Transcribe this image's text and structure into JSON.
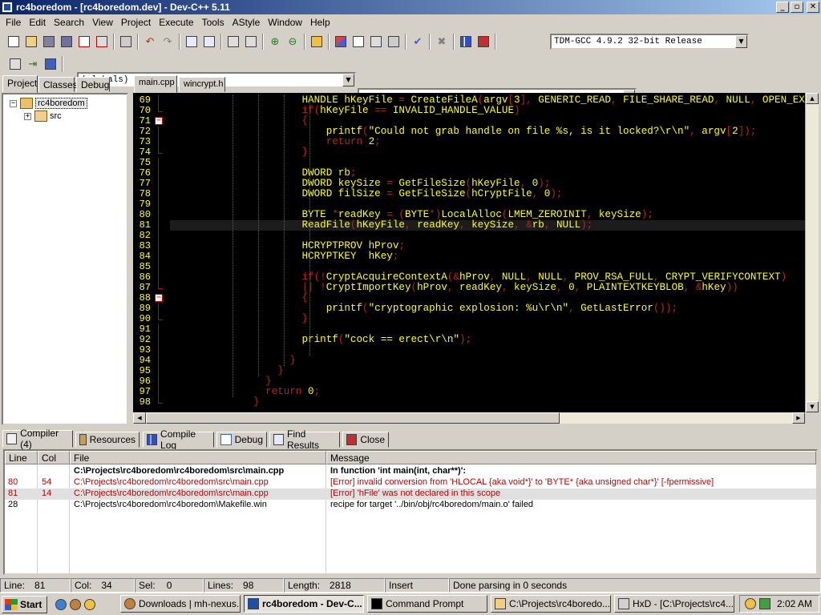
{
  "window": {
    "title": "rc4boredom - [rc4boredom.dev] - Dev-C++ 5.11",
    "minimize": "_",
    "restore": "▫",
    "close": "✕"
  },
  "menu": [
    "File",
    "Edit",
    "Search",
    "View",
    "Project",
    "Execute",
    "Tools",
    "AStyle",
    "Window",
    "Help"
  ],
  "toolbar": {
    "compiler_select": "TDM-GCC 4.9.2 32-bit Release",
    "scope_select": "(globals)",
    "member_select": ""
  },
  "left_panel": {
    "tabs": [
      "Project",
      "Classes",
      "Debug"
    ],
    "active_tab": "Project",
    "tree": {
      "root": "rc4boredom",
      "root_expander": "−",
      "child": "src",
      "child_expander": "+"
    }
  },
  "editor": {
    "tabs": [
      "main.cpp",
      "wincrypt.h"
    ],
    "active_tab": "main.cpp",
    "current_line": 81,
    "fold_marker": "−",
    "lines": [
      {
        "n": "69",
        "code": "        HANDLE hKeyFile = CreateFileA(argv[3], GENERIC_READ, FILE_SHARE_READ, NULL, OPEN_EX"
      },
      {
        "n": "70",
        "code": "        if(hKeyFile == INVALID_HANDLE_VALUE)"
      },
      {
        "n": "71",
        "code": "        {"
      },
      {
        "n": "72",
        "code": "            printf(\"Could not grab handle on file %s, is it locked?\\r\\n\", argv[2]);"
      },
      {
        "n": "73",
        "code": "            return 2;"
      },
      {
        "n": "74",
        "code": "        }"
      },
      {
        "n": "75",
        "code": ""
      },
      {
        "n": "76",
        "code": "        DWORD rb;"
      },
      {
        "n": "77",
        "code": "        DWORD keySize = GetFileSize(hKeyFile, 0);"
      },
      {
        "n": "78",
        "code": "        DWORD filSize = GetFileSize(hCryptFile, 0);"
      },
      {
        "n": "79",
        "code": ""
      },
      {
        "n": "80",
        "code": "        BYTE *readKey = (BYTE*)LocalAlloc(LMEM_ZEROINIT, keySize);"
      },
      {
        "n": "81",
        "code": "        ReadFile(hKeyFile, readKey, keySize, &rb, NULL);"
      },
      {
        "n": "82",
        "code": ""
      },
      {
        "n": "83",
        "code": "        HCRYPTPROV hProv;"
      },
      {
        "n": "84",
        "code": "        HCRYPTKEY  hKey;"
      },
      {
        "n": "85",
        "code": ""
      },
      {
        "n": "86",
        "code": "        if(!CryptAcquireContextA(&hProv, NULL, NULL, PROV_RSA_FULL, CRYPT_VERIFYCONTEXT)"
      },
      {
        "n": "87",
        "code": "        || !CryptImportKey(hProv, readKey, keySize, 0, PLAINTEXTKEYBLOB, &hKey))"
      },
      {
        "n": "88",
        "code": "        {"
      },
      {
        "n": "89",
        "code": "            printf(\"cryptographic explosion: %u\\r\\n\", GetLastError());"
      },
      {
        "n": "90",
        "code": "        }"
      },
      {
        "n": "91",
        "code": ""
      },
      {
        "n": "92",
        "code": "        printf(\"cock == erect\\r\\n\");"
      },
      {
        "n": "93",
        "code": ""
      },
      {
        "n": "94",
        "code": "      }"
      },
      {
        "n": "95",
        "code": "    }"
      },
      {
        "n": "96",
        "code": "  }"
      },
      {
        "n": "97",
        "code": "  return 0;"
      },
      {
        "n": "98",
        "code": "}"
      }
    ]
  },
  "bottom_panel": {
    "tabs": [
      "Compiler (4)",
      "Resources",
      "Compile Log",
      "Debug",
      "Find Results",
      "Close"
    ],
    "active_tab": "Compiler (4)",
    "columns": [
      "Line",
      "Col",
      "File",
      "Message"
    ],
    "rows": [
      {
        "line": "",
        "col": "",
        "file": "C:\\Projects\\rc4boredom\\rc4boredom\\src\\main.cpp",
        "message": "In function 'int main(int, char**)':",
        "style": "bold"
      },
      {
        "line": "80",
        "col": "54",
        "file": "C:\\Projects\\rc4boredom\\rc4boredom\\src\\main.cpp",
        "message": "[Error] invalid conversion from 'HLOCAL {aka void*}' to 'BYTE* {aka unsigned char*}' [-fpermissive]",
        "style": "err"
      },
      {
        "line": "81",
        "col": "14",
        "file": "C:\\Projects\\rc4boredom\\rc4boredom\\src\\main.cpp",
        "message": "[Error] 'hFile' was not declared in this scope",
        "style": "sel"
      },
      {
        "line": "28",
        "col": "",
        "file": "C:\\Projects\\rc4boredom\\rc4boredom\\Makefile.win",
        "message": "recipe for target '../bin/obj/rc4boredom/main.o' failed",
        "style": ""
      }
    ]
  },
  "status": {
    "line_label": "Line:",
    "line": "81",
    "col_label": "Col:",
    "col": "34",
    "sel_label": "Sel:",
    "sel": "0",
    "lines_label": "Lines:",
    "lines": "98",
    "length_label": "Length:",
    "length": "2818",
    "mode": "Insert",
    "message": "Done parsing in 0 seconds"
  },
  "taskbar": {
    "start": "Start",
    "items": [
      {
        "label": "Downloads | mh-nexus...",
        "active": false
      },
      {
        "label": "rc4boredom - Dev-C...",
        "active": true
      },
      {
        "label": "Command Prompt",
        "active": false
      },
      {
        "label": "C:\\Projects\\rc4boredo...",
        "active": false
      },
      {
        "label": "HxD - [C:\\Projects\\rc4...",
        "active": false
      }
    ],
    "clock": "2:02 AM"
  },
  "colors": {
    "title_start": "#0a246a",
    "title_end": "#a6caf0",
    "editor_bg": "#000000",
    "code_text": "#ffff00",
    "code_keyword": "#c02020",
    "error_text": "#c00000"
  }
}
